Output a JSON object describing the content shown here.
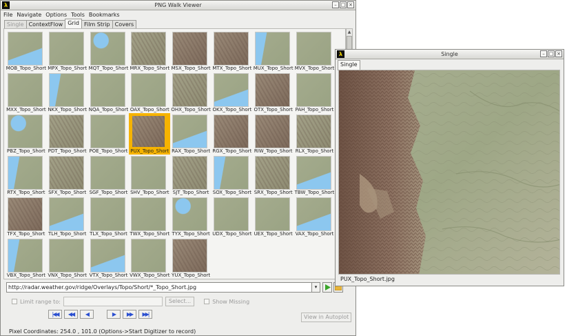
{
  "main_window": {
    "title": "PNG Walk Viewer",
    "menu": [
      "File",
      "Navigate",
      "Options",
      "Tools",
      "Bookmarks"
    ],
    "tabs": [
      {
        "label": "Single",
        "state": "disabled"
      },
      {
        "label": "ContextFlow",
        "state": "normal"
      },
      {
        "label": "Grid",
        "state": "active"
      },
      {
        "label": "Film Strip",
        "state": "normal"
      },
      {
        "label": "Covers",
        "state": "normal"
      }
    ],
    "grid": [
      {
        "label": "MOB_Topo_Short",
        "terrain": "coast"
      },
      {
        "label": "MPX_Topo_Short",
        "terrain": "plain"
      },
      {
        "label": "MQT_Topo_Short",
        "terrain": "lake"
      },
      {
        "label": "MRX_Topo_Short",
        "terrain": "hills"
      },
      {
        "label": "MSX_Topo_Short",
        "terrain": "mountain"
      },
      {
        "label": "MTX_Topo_Short",
        "terrain": "mountain"
      },
      {
        "label": "MUX_Topo_Short",
        "terrain": "coast-west"
      },
      {
        "label": "MVX_Topo_Short",
        "terrain": "plain"
      },
      {
        "label": "MXX_Topo_Short",
        "terrain": "plain"
      },
      {
        "label": "NKX_Topo_Short",
        "terrain": "coast-west"
      },
      {
        "label": "NQA_Topo_Short",
        "terrain": "plain"
      },
      {
        "label": "OAX_Topo_Short",
        "terrain": "plain"
      },
      {
        "label": "OHX_Topo_Short",
        "terrain": "hills"
      },
      {
        "label": "OKX_Topo_Short",
        "terrain": "coast"
      },
      {
        "label": "OTX_Topo_Short",
        "terrain": "mountain"
      },
      {
        "label": "PAH_Topo_Short",
        "terrain": "plain"
      },
      {
        "label": "PBZ_Topo_Short",
        "terrain": "lake"
      },
      {
        "label": "PDT_Topo_Short",
        "terrain": "hills"
      },
      {
        "label": "POE_Topo_Short",
        "terrain": "plain"
      },
      {
        "label": "PUX_Topo_Short",
        "terrain": "mountain"
      },
      {
        "label": "RAX_Topo_Short",
        "terrain": "coast"
      },
      {
        "label": "RGX_Topo_Short",
        "terrain": "mountain"
      },
      {
        "label": "RIW_Topo_Short",
        "terrain": "mountain"
      },
      {
        "label": "RLX_Topo_Short",
        "terrain": "hills"
      },
      {
        "label": "RTX_Topo_Short",
        "terrain": "coast-west"
      },
      {
        "label": "SFX_Topo_Short",
        "terrain": "hills"
      },
      {
        "label": "SGF_Topo_Short",
        "terrain": "plain"
      },
      {
        "label": "SHV_Topo_Short",
        "terrain": "plain"
      },
      {
        "label": "SJT_Topo_Short",
        "terrain": "hills"
      },
      {
        "label": "SOX_Topo_Short",
        "terrain": "coast-west"
      },
      {
        "label": "SRX_Topo_Short",
        "terrain": "hills"
      },
      {
        "label": "TBW_Topo_Short",
        "terrain": "coast"
      },
      {
        "label": "TFX_Topo_Short",
        "terrain": "mountain"
      },
      {
        "label": "TLH_Topo_Short",
        "terrain": "coast"
      },
      {
        "label": "TLX_Topo_Short",
        "terrain": "plain"
      },
      {
        "label": "TWX_Topo_Short",
        "terrain": "plain"
      },
      {
        "label": "TYX_Topo_Short",
        "terrain": "lake"
      },
      {
        "label": "UDX_Topo_Short",
        "terrain": "plain"
      },
      {
        "label": "UEX_Topo_Short",
        "terrain": "plain"
      },
      {
        "label": "VAX_Topo_Short",
        "terrain": "coast"
      },
      {
        "label": "VBX_Topo_Short",
        "terrain": "coast-west"
      },
      {
        "label": "VNX_Topo_Short",
        "terrain": "plain"
      },
      {
        "label": "VTX_Topo_Short",
        "terrain": "coast"
      },
      {
        "label": "VWX_Topo_Short",
        "terrain": "plain"
      },
      {
        "label": "YUX_Topo_Short",
        "terrain": "mountain"
      }
    ],
    "selected_index": 19,
    "url": "http://radar.weather.gov/ridge/Overlays/Topo/Short/*_Topo_Short.jpg",
    "limit_range_label": "Limit range to:",
    "select_button": "Select...",
    "show_missing_label": "Show Missing",
    "view_autoplot_button": "View in Autoplot",
    "status": "Pixel Coordinates: 254.0 , 101.0   (Options->Start Digitizer to record)"
  },
  "single_window": {
    "title": "Single",
    "tab": "Single",
    "caption": "PUX_Topo_Short.jpg"
  },
  "colors": {
    "selection": "#f6b300",
    "water": "#8cc7ef",
    "nav_arrow": "#2a4fd0"
  }
}
